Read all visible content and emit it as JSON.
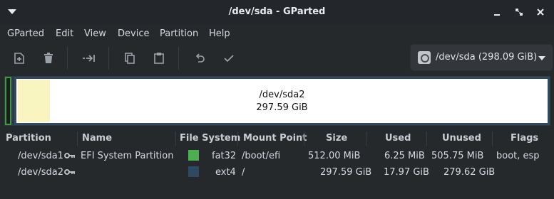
{
  "window": {
    "title": "/dev/sda - GParted"
  },
  "menubar": [
    {
      "label": "GParted"
    },
    {
      "label": "Edit"
    },
    {
      "label": "View"
    },
    {
      "label": "Device"
    },
    {
      "label": "Partition"
    },
    {
      "label": "Help"
    }
  ],
  "toolbar": {
    "buttons": [
      "new-partition-icon",
      "delete-icon",
      "resize-move-icon",
      "copy-icon",
      "paste-icon",
      "undo-icon",
      "apply-icon"
    ]
  },
  "device_select": {
    "label": "/dev/sda (298.09 GiB)",
    "icon": "hard-disk-icon"
  },
  "disk_map": {
    "partition_name": "/dev/sda2",
    "partition_size": "297.59 GiB",
    "sda1_border_color": "#3f9a3f",
    "sda2_border_color": "#2e4a63",
    "used_color": "#f8f5c0"
  },
  "table": {
    "headers": {
      "partition": "Partition",
      "name": "Name",
      "filesystem": "File System",
      "mount": "Mount Point",
      "size": "Size",
      "used": "Used",
      "unused": "Unused",
      "flags": "Flags"
    },
    "rows": [
      {
        "partition": "/dev/sda1",
        "name": "EFI System Partition",
        "fs_color": "#4caf50",
        "filesystem": "fat32",
        "mount": "/boot/efi",
        "size": "512.00 MiB",
        "used": "6.25 MiB",
        "unused": "505.75 MiB",
        "flags": "boot, esp"
      },
      {
        "partition": "/dev/sda2",
        "name": "",
        "fs_color": "#2e4a63",
        "filesystem": "ext4",
        "mount": "/",
        "size": "297.59 GiB",
        "used": "17.97 GiB",
        "unused": "279.62 GiB",
        "flags": ""
      }
    ]
  }
}
